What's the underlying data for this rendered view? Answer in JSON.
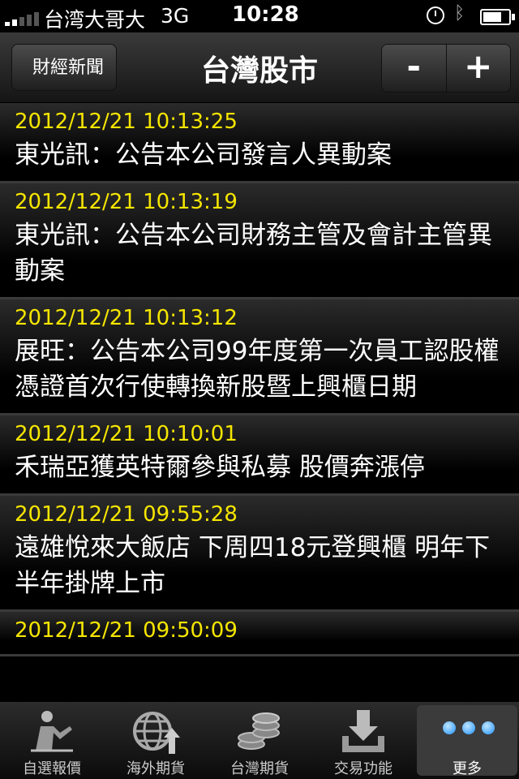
{
  "status_bar": {
    "carrier": "台湾大哥大",
    "network": "3G",
    "time": "10:28"
  },
  "nav": {
    "back_label": "財經新聞",
    "title": "台灣股市",
    "minus_label": "-",
    "plus_label": "+"
  },
  "news": [
    {
      "time": "2012/12/21 10:13:25",
      "headline": "東光訊：公告本公司發言人異動案"
    },
    {
      "time": "2012/12/21 10:13:19",
      "headline": "東光訊：公告本公司財務主管及會計主管異動案"
    },
    {
      "time": "2012/12/21 10:13:12",
      "headline": "展旺：公告本公司99年度第一次員工認股權憑證首次行使轉換新股暨上興櫃日期"
    },
    {
      "time": "2012/12/21 10:10:01",
      "headline": "禾瑞亞獲英特爾參與私募 股價奔漲停"
    },
    {
      "time": "2012/12/21 09:55:28",
      "headline": "遠雄悅來大飯店 下周四18元登興櫃 明年下半年掛牌上市"
    },
    {
      "time": "2012/12/21 09:50:09",
      "headline": ""
    }
  ],
  "tabbar": [
    {
      "label": "自選報價",
      "icon": "person-chart-icon"
    },
    {
      "label": "海外期貨",
      "icon": "globe-arrow-icon"
    },
    {
      "label": "台灣期貨",
      "icon": "coins-icon"
    },
    {
      "label": "交易功能",
      "icon": "download-tray-icon"
    },
    {
      "label": "更多",
      "icon": "more-dots-icon"
    }
  ],
  "colors": {
    "time_text": "#f5e500",
    "background": "#000000",
    "more_dots": "#1e90ff"
  }
}
